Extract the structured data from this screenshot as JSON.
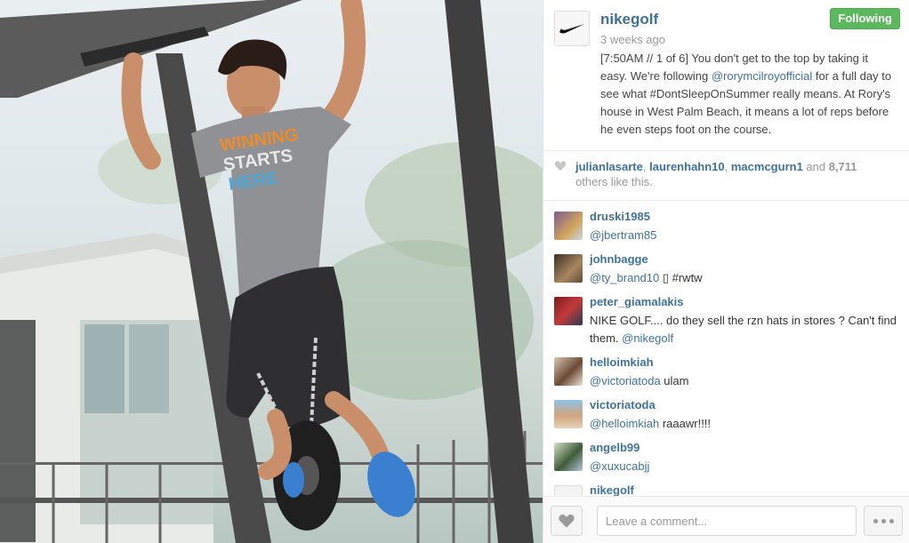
{
  "post": {
    "username": "nikegolf",
    "time_ago": "3 weeks ago",
    "follow_label": "Following",
    "caption": {
      "part1": "[7:50AM // 1 of 6] You don't get to the top by taking it easy. We're following ",
      "mention": "@rorymcilroyofficial",
      "part2": " for a full day to see what #DontSleepOnSummer really means. At Rory's house in West Palm Beach, it means a lot of reps before he even steps foot on the course."
    },
    "shirt_text": [
      "WINNING",
      "STARTS",
      "HERE"
    ]
  },
  "likes": {
    "user1": "julianlasarte",
    "user2": "laurenhahn10",
    "user3": "macmcgurn1",
    "and_text": " and ",
    "count": "8,711",
    "suffix": "others like this."
  },
  "comments": [
    {
      "user": "druski1985",
      "mention": "@jbertram85",
      "text": ""
    },
    {
      "user": "johnbagge",
      "mention": "@ty_brand10",
      "text": " ▯ #rwtw"
    },
    {
      "user": "peter_giamalakis",
      "text": "NIKE GOLF.... do they sell the rzn hats in stores ? Can't find them. ",
      "mention": "@nikegolf"
    },
    {
      "user": "helloimkiah",
      "mention": "@victoriatoda",
      "text": " ulam"
    },
    {
      "user": "victoriatoda",
      "mention": "@helloimkiah",
      "text": " raaawr!!!!"
    },
    {
      "user": "angelb99",
      "mention": "@xuxucabjj",
      "text": ""
    },
    {
      "user": "nikegolf",
      "mention": "",
      "text": ""
    }
  ],
  "footer": {
    "comment_placeholder": "Leave a comment..."
  },
  "colors": {
    "link": "#3f729b",
    "follow_green": "#5cb85c"
  },
  "icons": [
    "nike-swoosh-icon",
    "heart-icon",
    "more-dots-icon"
  ]
}
